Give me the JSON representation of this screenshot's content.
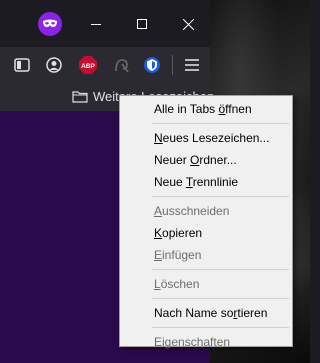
{
  "bookmarks_bar": {
    "other_bookmarks_label": "Weitere Lesezeichen"
  },
  "context_menu": {
    "items": [
      {
        "pre": "Alle in Tabs ",
        "acc": "ö",
        "post": "ffnen",
        "disabled": false
      },
      {
        "pre": "",
        "acc": "N",
        "post": "eues Lesezeichen...",
        "disabled": false
      },
      {
        "pre": "Neuer ",
        "acc": "O",
        "post": "rdner...",
        "disabled": false
      },
      {
        "pre": "Neue ",
        "acc": "T",
        "post": "rennlinie",
        "disabled": false
      },
      {
        "pre": "",
        "acc": "A",
        "post": "usschneiden",
        "disabled": true
      },
      {
        "pre": "",
        "acc": "K",
        "post": "opieren",
        "disabled": false
      },
      {
        "pre": "",
        "acc": "E",
        "post": "infügen",
        "disabled": true
      },
      {
        "pre": "",
        "acc": "L",
        "post": "öschen",
        "disabled": true
      },
      {
        "pre": "Nach Name so",
        "acc": "r",
        "post": "tieren",
        "disabled": false
      },
      {
        "pre": "Ei",
        "acc": "g",
        "post": "enschaften",
        "disabled": true
      }
    ]
  },
  "colors": {
    "private_browsing_accent": "#8c22e8",
    "menu_background": "#f0f0f0",
    "content_background": "#2a0a4a"
  },
  "icons": [
    "private-mask-icon",
    "minimize-icon",
    "maximize-icon",
    "close-icon",
    "sidebar-icon",
    "account-icon",
    "adblock-plus-icon",
    "extension-icon",
    "bitwarden-icon",
    "hamburger-menu-icon",
    "folder-icon"
  ]
}
